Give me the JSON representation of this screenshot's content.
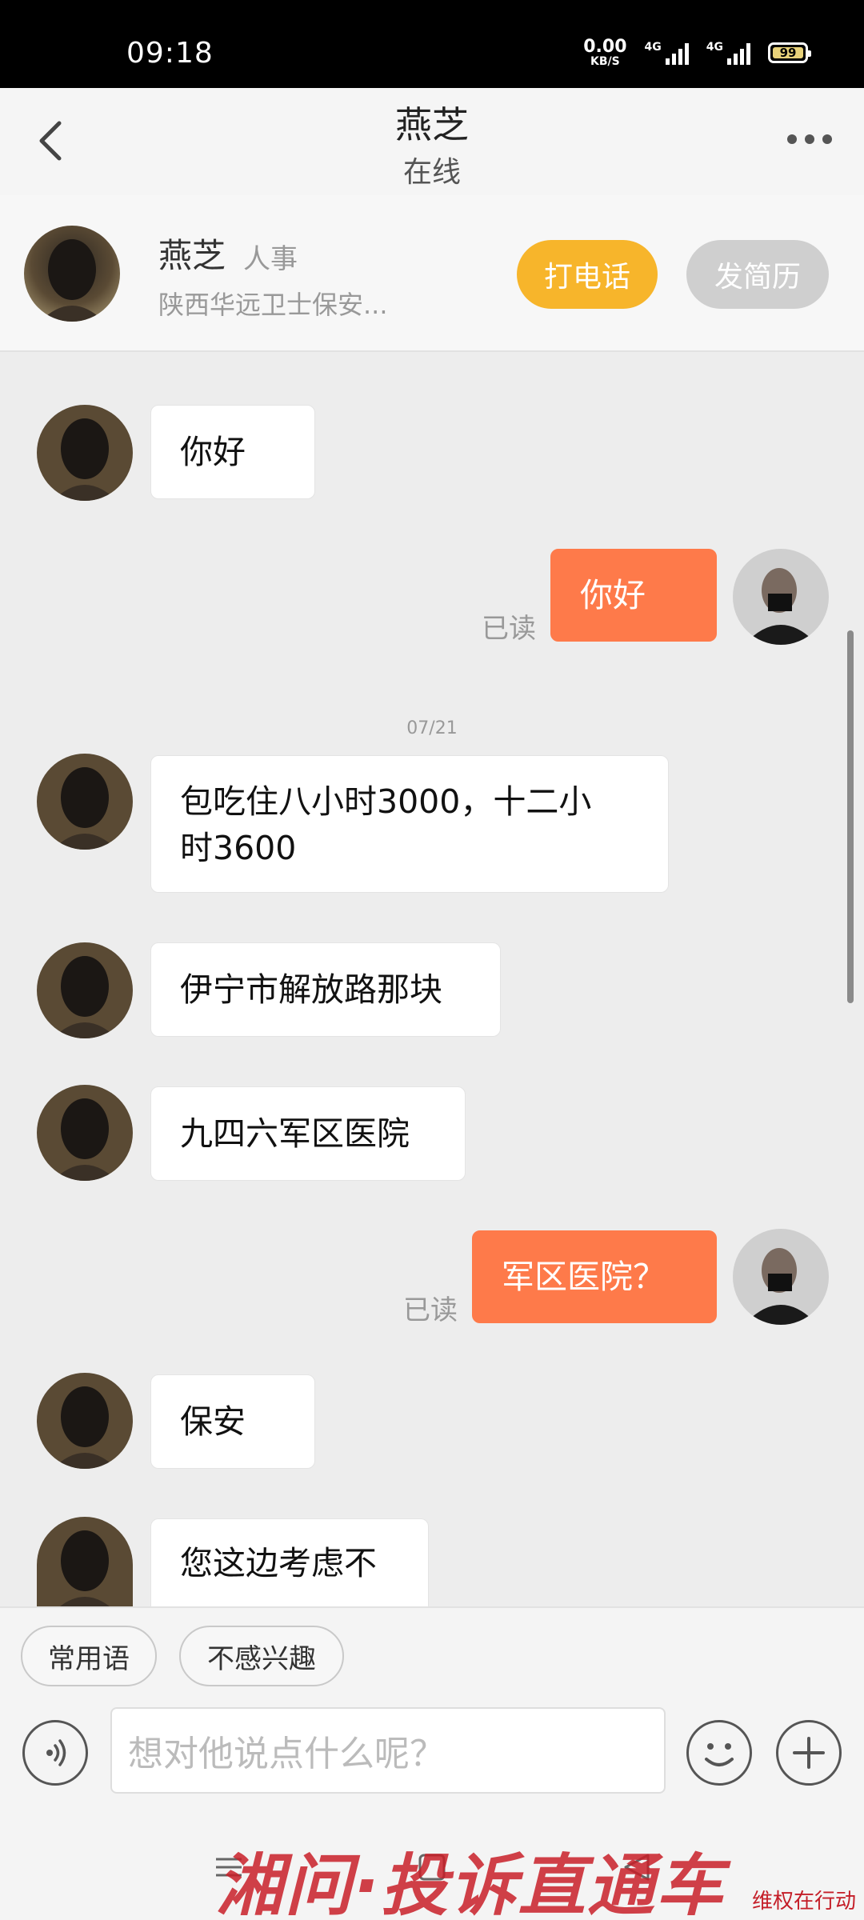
{
  "status_bar": {
    "time": "09:18",
    "net_speed_value": "0.00",
    "net_speed_unit": "KB/S",
    "signal1_label": "4G",
    "signal2_label": "4G",
    "battery": "99"
  },
  "header": {
    "title": "燕芝",
    "subtitle": "在线",
    "back_icon": "chevron-left-icon",
    "more_icon": "more-dots-icon"
  },
  "contact_card": {
    "name": "燕芝",
    "role": "人事",
    "company": "陕西华远卫士保安...",
    "call_label": "打电话",
    "resume_label": "发简历",
    "call_color": "#f7b52b"
  },
  "chat": {
    "date_separator": "07/21",
    "read_label": "已读",
    "messages": [
      {
        "from": "them",
        "text": "你好"
      },
      {
        "from": "me",
        "text": "你好",
        "status": "已读"
      },
      {
        "from": "them",
        "text_line1": "包吃住八小时3000，十二小",
        "text_line2": "时3600"
      },
      {
        "from": "them",
        "text": "伊宁市解放路那块"
      },
      {
        "from": "them",
        "text": "九四六军区医院"
      },
      {
        "from": "me",
        "text": "军区医院？",
        "status": "已读"
      },
      {
        "from": "them",
        "text": "保安"
      },
      {
        "from": "them",
        "text": "您这边考虑不"
      }
    ],
    "my_bubble_color": "#fe7a4a"
  },
  "quick_phrases": [
    "常用语",
    "不感兴趣"
  ],
  "input": {
    "placeholder": "想对他说点什么呢？"
  },
  "watermark": {
    "text": "湘问·投诉直通车",
    "small_text": "维权在行动"
  }
}
